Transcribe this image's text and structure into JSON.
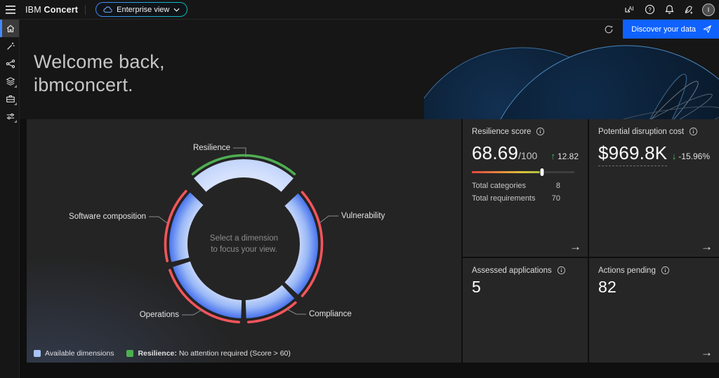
{
  "header": {
    "brand": "IBM",
    "product": "Concert",
    "view_switcher": "Enterprise view",
    "avatar_initial": "I"
  },
  "toolbar": {
    "discover_button": "Discover your data"
  },
  "sidebar": {
    "items": [
      {
        "icon": "home",
        "selected": true
      },
      {
        "icon": "magic-wand",
        "selected": false
      },
      {
        "icon": "network",
        "selected": false
      },
      {
        "icon": "layers",
        "selected": false,
        "flyout": true
      },
      {
        "icon": "toolbox",
        "selected": false,
        "flyout": true
      },
      {
        "icon": "filter",
        "selected": false,
        "flyout": true
      }
    ]
  },
  "hero": {
    "line1": "Welcome back,",
    "line2": "ibmconcert."
  },
  "chart_data": {
    "type": "donut",
    "title": "Dimension focus donut",
    "center_text": [
      "Select a dimension",
      "to focus your view."
    ],
    "segments": [
      {
        "label": "Resilience",
        "start": -42,
        "end": 42,
        "exploded": true,
        "status_color": "#4fae53",
        "status": "No attention required"
      },
      {
        "label": "Vulnerability",
        "start": 47,
        "end": 133,
        "exploded": false,
        "status_color": "#f4555c",
        "status": "Attention required"
      },
      {
        "label": "Compliance",
        "start": 137,
        "end": 178,
        "exploded": false,
        "status_color": "#f4555c",
        "status": "Attention required"
      },
      {
        "label": "Operations",
        "start": 182,
        "end": 252,
        "exploded": false,
        "status_color": "#f4555c",
        "status": "Attention required"
      },
      {
        "label": "Software composition",
        "start": 256,
        "end": 314,
        "exploded": false,
        "status_color": "#f4555c",
        "status": "Attention required"
      }
    ],
    "legend": [
      {
        "color": "#a9c4f6",
        "bold": "",
        "text": "Available dimensions"
      },
      {
        "color": "#4caf50",
        "bold": "Resilience:",
        "text": " No attention required (Score > 60)"
      }
    ]
  },
  "cards": {
    "resilience_score": {
      "title": "Resilience score",
      "value": "68.69",
      "denom": "/100",
      "delta_dir": "↑",
      "delta": "12.82",
      "progress_pct": 68.69,
      "rows": [
        {
          "label": "Total categories",
          "value": "8"
        },
        {
          "label": "Total requirements",
          "value": "70"
        }
      ],
      "arrow": "→"
    },
    "disruption_cost": {
      "title": "Potential disruption cost",
      "value": "$969.8K",
      "delta_dir": "↓",
      "delta": "-15.96%",
      "arrow": "→"
    },
    "assessed_apps": {
      "title": "Assessed applications",
      "value": "5"
    },
    "actions_pending": {
      "title": "Actions pending",
      "value": "82",
      "arrow": "→"
    }
  }
}
